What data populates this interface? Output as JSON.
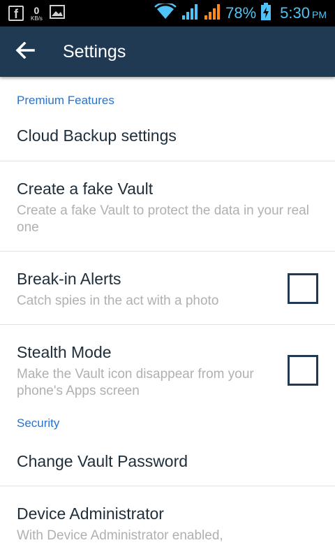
{
  "status_bar": {
    "network_speed": "0",
    "network_speed_unit": "KB/s",
    "battery_percent": "78%",
    "time": "5:30",
    "ampm": "PM",
    "icons": [
      "facebook-icon",
      "network-speed",
      "gallery-icon",
      "wifi-icon",
      "signal-icon",
      "signal-icon-2",
      "battery-charging-icon"
    ],
    "icon_color": "#4fc3f7"
  },
  "app_bar": {
    "title": "Settings",
    "background": "#1f3a52",
    "back_icon": "arrow-left-icon"
  },
  "sections": {
    "premium": {
      "header": "Premium Features",
      "items": [
        {
          "title": "Cloud Backup settings"
        },
        {
          "title": "Create a fake Vault",
          "summary": "Create a fake Vault to protect the data in your real one"
        },
        {
          "title": "Break-in Alerts",
          "summary": "Catch spies in the act with a photo",
          "checked": false
        },
        {
          "title": "Stealth Mode",
          "summary": "Make the Vault icon disappear from your phone's Apps screen",
          "checked": false
        }
      ]
    },
    "security": {
      "header": "Security",
      "items": [
        {
          "title": "Change Vault Password"
        },
        {
          "title": "Device Administrator",
          "summary": "With Device Administrator enabled,"
        }
      ]
    }
  },
  "colors": {
    "accent": "#2b72c9",
    "title_text": "#1e2d3a",
    "summary_text": "#b0b0b0"
  }
}
